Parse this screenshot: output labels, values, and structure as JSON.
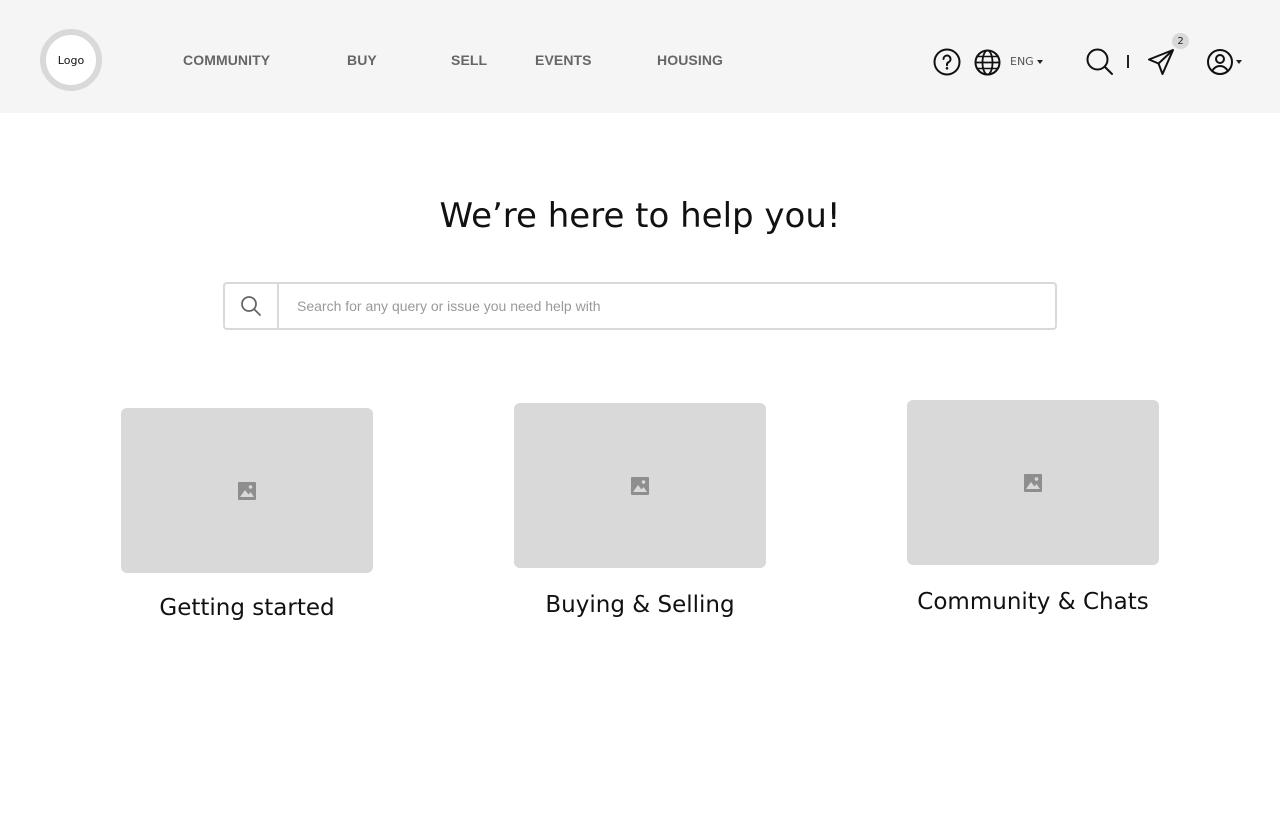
{
  "header": {
    "logo_text": "Logo",
    "nav": [
      {
        "label": "COMMUNITY"
      },
      {
        "label": "BUY"
      },
      {
        "label": "SELL"
      },
      {
        "label": "EVENTS"
      },
      {
        "label": "HOUSING"
      }
    ],
    "language": "ENG",
    "messages_badge": "2",
    "icons": [
      "help-icon",
      "globe-icon",
      "search-icon",
      "send-icon",
      "user-icon"
    ]
  },
  "hero": {
    "title": "We’re here to help you!"
  },
  "search": {
    "placeholder": "Search for any query or issue you need help with"
  },
  "cards": [
    {
      "title": "Getting started"
    },
    {
      "title": "Buying & Selling"
    },
    {
      "title": "Community & Chats"
    }
  ],
  "colors": {
    "header_bg": "#f5f5f5",
    "placeholder_gray": "#d9d9d9",
    "nav_text": "#666666"
  }
}
